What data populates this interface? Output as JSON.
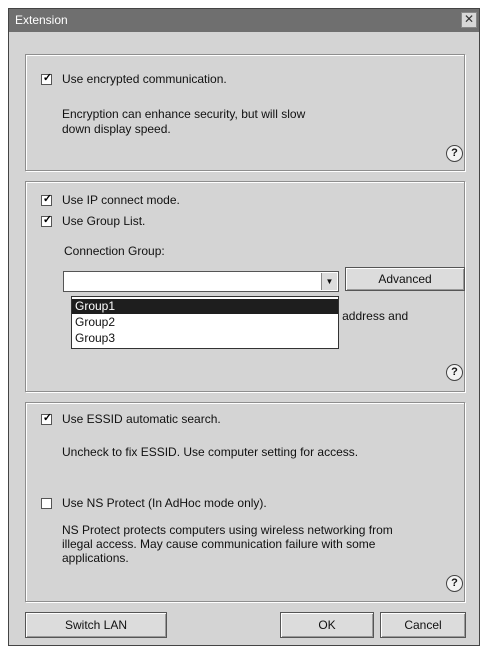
{
  "window": {
    "title": "Extension",
    "close_glyph": "✕"
  },
  "encryption": {
    "checkbox_checked": true,
    "checkbox_label": "Use encrypted communication.",
    "description": "Encryption can enhance security, but will slow down display speed."
  },
  "connection": {
    "ip_mode_checked": true,
    "ip_mode_label": "Use IP connect mode.",
    "group_list_checked": true,
    "group_list_label": "Use Group List.",
    "connection_group_label": "Connection Group:",
    "combo_value": "",
    "advanced_label": "Advanced",
    "dropdown_options": [
      "Group1",
      "Group2",
      "Group3"
    ],
    "selected_option": "Group1",
    "partial_text": "P address and"
  },
  "wireless": {
    "essid_checked": true,
    "essid_label": "Use ESSID automatic search.",
    "essid_description": "Uncheck to fix ESSID. Use computer setting for access.",
    "ns_checked": false,
    "ns_label": "Use NS Protect (In AdHoc mode only).",
    "ns_description": "NS Protect protects computers using wireless networking from illegal access. May cause communication failure with some applications."
  },
  "help_glyph": "?",
  "check_glyph": "✓",
  "buttons": {
    "switch_lan": "Switch LAN",
    "ok": "OK",
    "cancel": "Cancel"
  }
}
